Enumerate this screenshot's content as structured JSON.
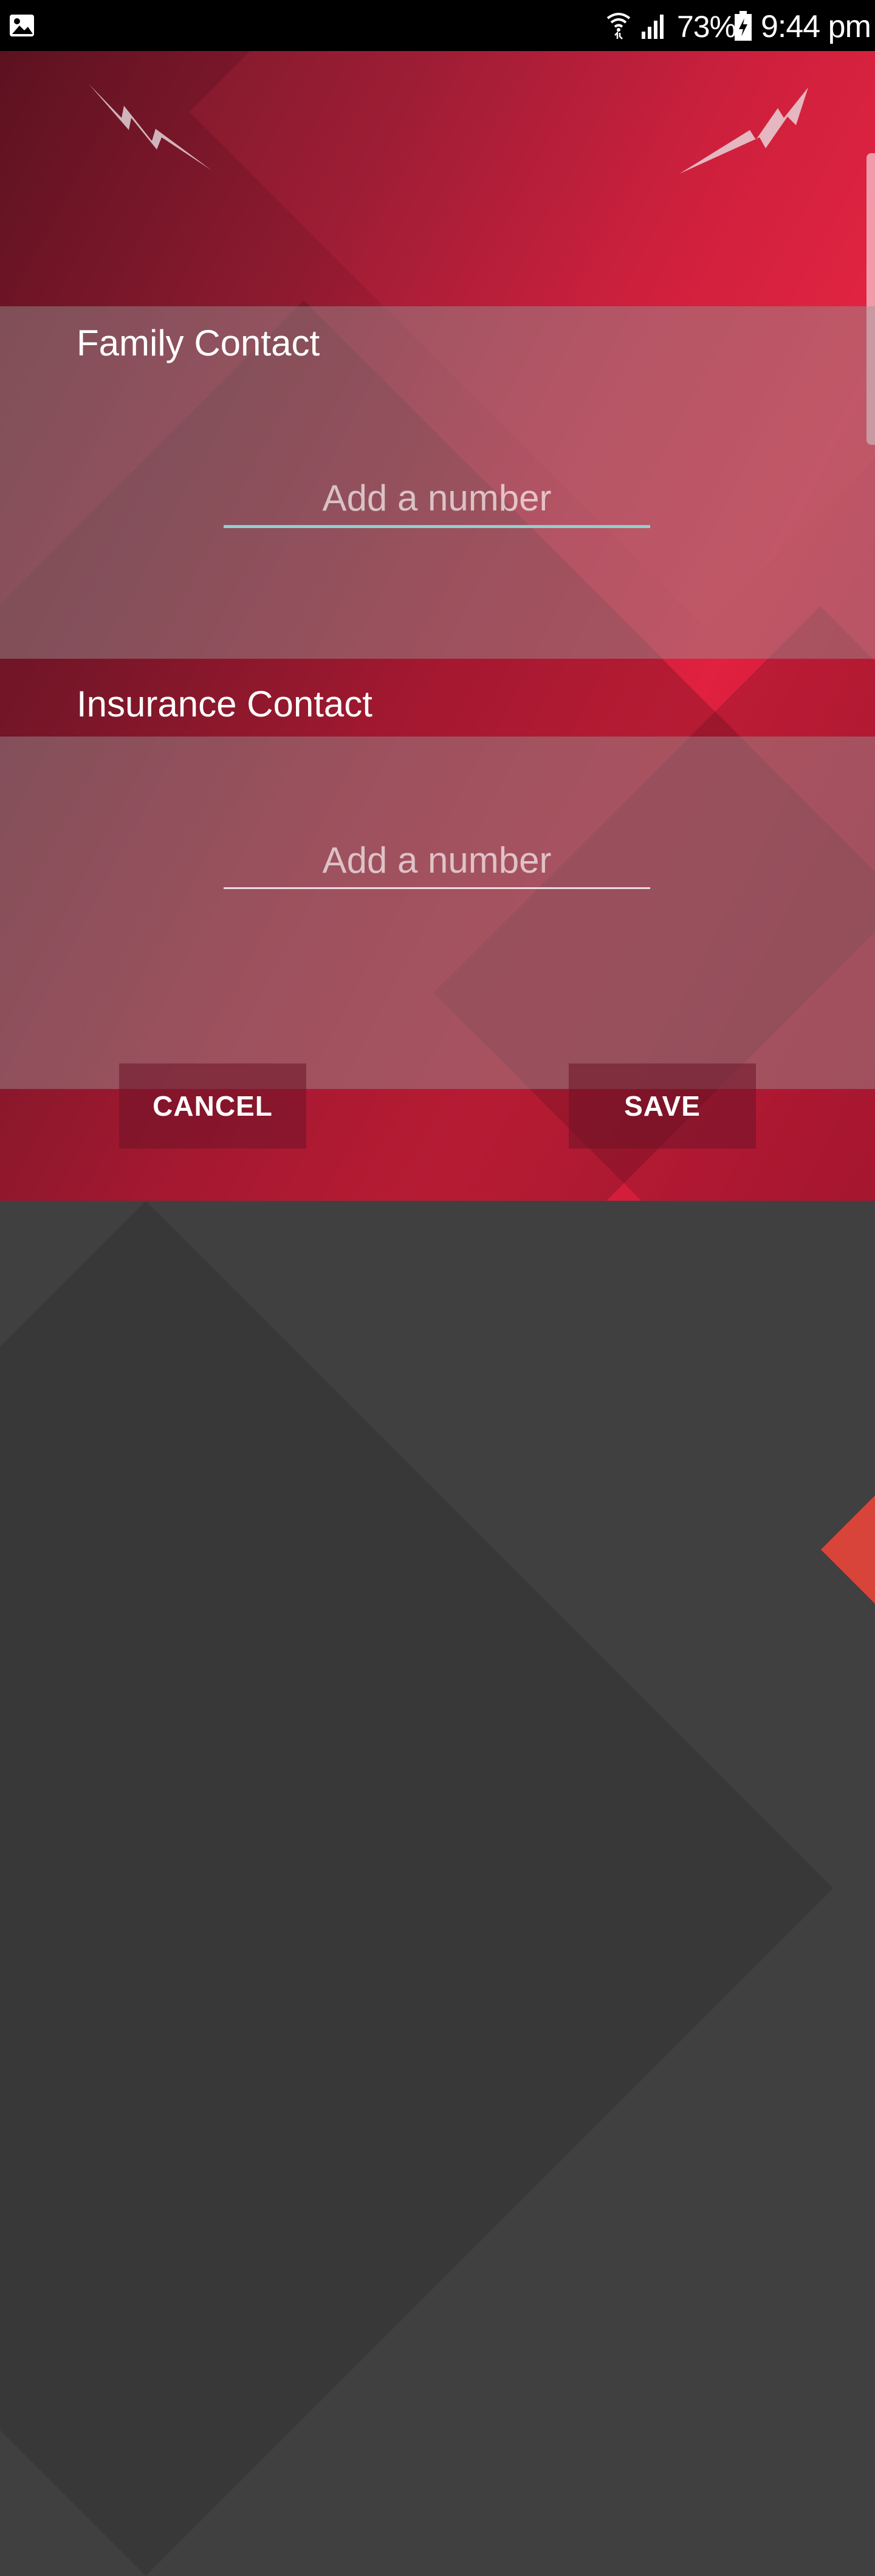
{
  "status_bar": {
    "battery_percent": "73%",
    "time": "9:44 pm",
    "icons": [
      "image-notification-icon",
      "wifi-icon",
      "signal-icon",
      "battery-charging-icon"
    ]
  },
  "family": {
    "label": "Family Contact",
    "placeholder": "Add a number",
    "value": ""
  },
  "insurance": {
    "label": "Insurance Contact",
    "placeholder": "Add a number",
    "value": ""
  },
  "actions": {
    "cancel_label": "CANCEL",
    "save_label": "SAVE"
  },
  "colors": {
    "accent_underline": "#8fd0cf",
    "background_red": "#e0213f",
    "launcher_gray": "#404040"
  }
}
